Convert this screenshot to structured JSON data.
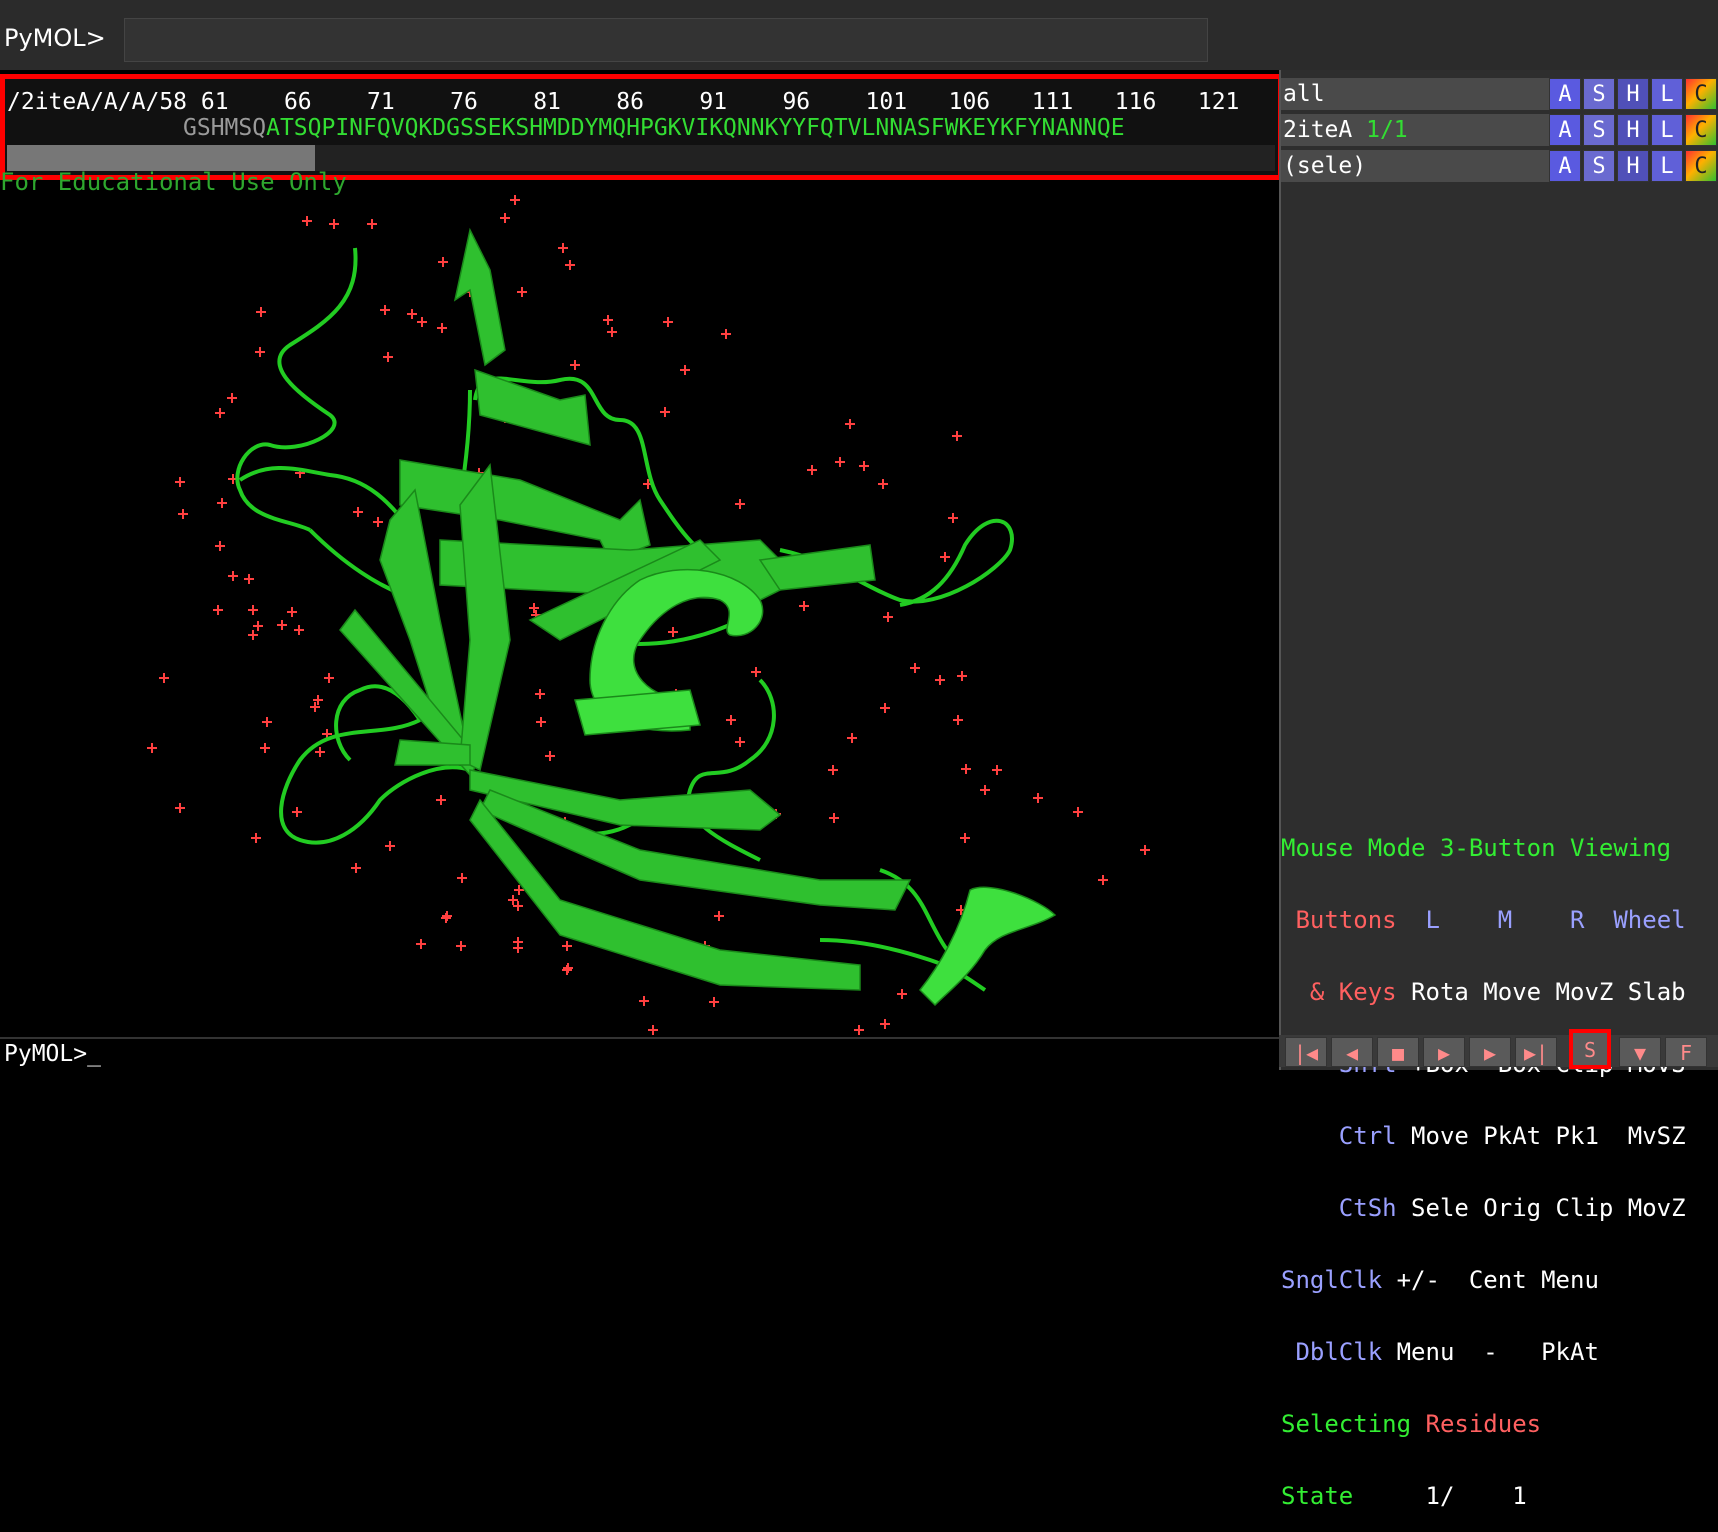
{
  "top": {
    "prompt": "PyMOL>",
    "command": ""
  },
  "sequence": {
    "header": "/2iteA/A/A/58 61    66    71    76    81    86    91    96    101   106   111   116   121",
    "grey": "GSHMSQ",
    "green": "ATSQPINFQVQKDGSSEKSHMDDYMQHPGKVIKQNNKYYFQTVLNNASFWKEYKFYNANNQE"
  },
  "watermark": "For Educational Use Only",
  "objects": [
    {
      "name": "all",
      "state": ""
    },
    {
      "name": "2iteA",
      "state": "1/1"
    },
    {
      "name": "(sele)",
      "state": ""
    }
  ],
  "object_buttons": [
    "A",
    "S",
    "H",
    "L",
    "C"
  ],
  "mouse": {
    "title": "Mouse Mode 3-Button Viewing",
    "buttons_label": " Buttons",
    "col_L": "L",
    "col_M": "M",
    "col_R": "R",
    "col_Wheel": "Wheel",
    "keys_label": "& Keys",
    "rows": [
      {
        "key": "& Keys",
        "vals": "Rota Move MovZ Slab"
      },
      {
        "key": "Shft",
        "vals": "+Box -Box Clip MovS"
      },
      {
        "key": "Ctrl",
        "vals": "Move PkAt Pk1  MvSZ"
      },
      {
        "key": "CtSh",
        "vals": "Sele Orig Clip MovZ"
      },
      {
        "key": "SnglClk",
        "vals": "+/-  Cent Menu"
      },
      {
        "key": "DblClk",
        "vals": "Menu  -   PkAt"
      }
    ],
    "selecting": "Selecting",
    "selecting_val": "Residues",
    "state_label": "State",
    "state_val": "1/    1"
  },
  "bottom": {
    "prompt": "PyMOL>_"
  },
  "playback": [
    "|◀",
    "◀",
    "■",
    "▶",
    "▶",
    "▶|",
    "S",
    "▼",
    "F"
  ]
}
